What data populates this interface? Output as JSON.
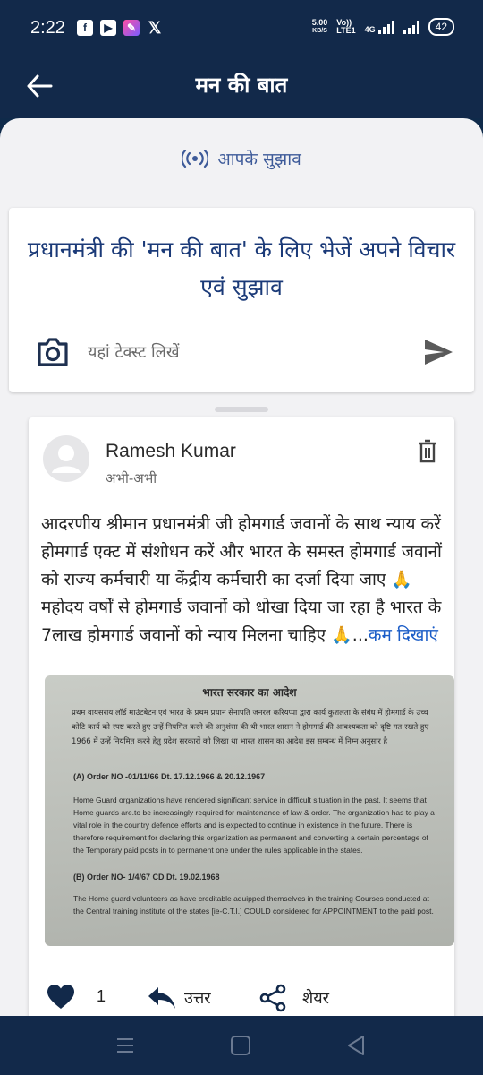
{
  "status_bar": {
    "time": "2:22",
    "net_speed_value": "5.00",
    "net_speed_unit": "KB/S",
    "volte_top": "Vo))",
    "volte_bottom": "LTE1",
    "network": "4G",
    "battery": "42"
  },
  "app_bar": {
    "title": "मन की बात"
  },
  "subtitle": {
    "label": "आपके सुझाव",
    "color": "#3d5a99"
  },
  "compose": {
    "heading": "प्रधानमंत्री की 'मन की बात' के लिए भेजें अपने विचार एवं सुझाव",
    "placeholder": "यहां टेक्स्ट लिखें"
  },
  "post": {
    "author": "Ramesh Kumar",
    "time": "अभी-अभी",
    "body": "आदरणीय श्रीमान प्रधानमंत्री जी होमगार्ड जवानों के साथ न्याय करें होमगार्ड एक्ट में संशोधन करें और भारत के समस्त होमगार्ड जवानों को राज्य कर्मचारी या केंद्रीय कर्मचारी का दर्जा दिया जाए 🙏 महोदय वर्षों से होमगार्ड जवानों को धोखा दिया जा रहा है भारत के 7लाख होमगार्ड जवानों को न्याय मिलना चाहिए 🙏...",
    "show_less": "कम दिखाएं",
    "image": {
      "title": "भारत सरकार का आदेश",
      "hindi_text": "प्रथम वायसराय लॉर्ड माउंटबेटन एवं भारत के प्रथम प्रधान सेनापति जनरल करियप्पा द्वारा कार्य कुशलता के संबंध में होमगार्ड के उच्च कोटि कार्य को स्पष्ट करते हुए उन्हें नियमित करने की अनुशंसा की थी भारत शासन ने होमगार्ड की आवश्यकता को दृष्टि गत रखते हुए 1966 में उन्हें नियमित करने हेतु प्रदेश सरकारों को लिखा था भारत शासन का आदेश इस सम्बन्ध में निम्न अनुसार है",
      "order_a": "(A) Order NO -01/11/66 Dt. 17.12.1966 & 20.12.1967",
      "order_a_text": "Home Guard organizations have rendered significant service in difficult situation in the past. It seems that Home guards are.to be increasingly required for maintenance of law & order. The organization has to play a vital role in the country defence efforts and is expected to continue in existence in the future. There is therefore requirement for declaring this organization as permanent and converting a certain percentage of the Temporary paid posts in to permanent one under the rules applicable in the states.",
      "order_b": "(B) Order NO- 1/4/67 CD Dt. 19.02.1968",
      "order_b_text": "The Home guard volunteers as have creditable aquipped themselves in the training Courses conducted at the Central training institute of the states [ie-C.T.I.] COULD considered for APPOINTMENT to the paid post."
    },
    "likes": "1",
    "reply_label": "उत्तर",
    "share_label": "शेयर"
  },
  "colors": {
    "brand_dark": "#12294a",
    "heading_blue": "#1b3a78",
    "link_blue": "#1a5cc7"
  }
}
